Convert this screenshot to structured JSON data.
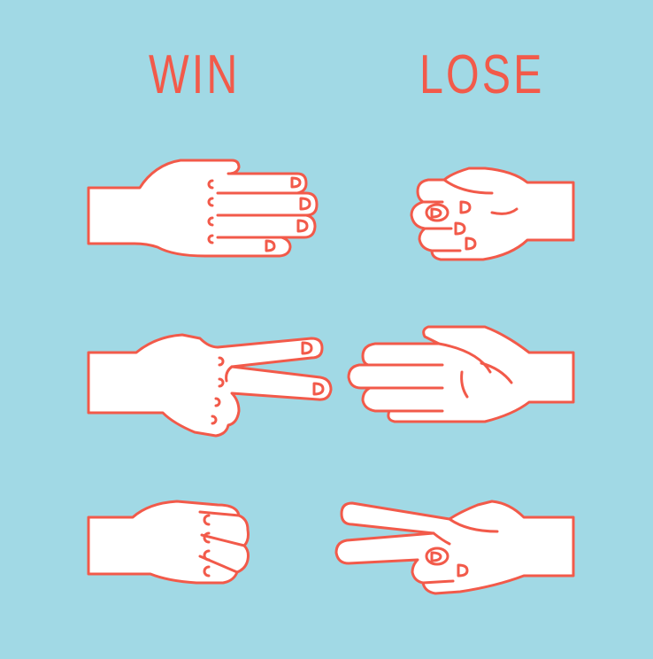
{
  "columns": {
    "win": "WIN",
    "lose": "LOSE"
  },
  "palette": {
    "background": "#a1d9e5",
    "stroke": "#f25a4a",
    "hand_fill": "#ffffff"
  },
  "rows": [
    {
      "win": "paper-hand-icon",
      "lose": "rock-hand-icon"
    },
    {
      "win": "scissors-hand-icon",
      "lose": "paper-hand-icon"
    },
    {
      "win": "rock-hand-icon",
      "lose": "scissors-hand-icon"
    }
  ]
}
